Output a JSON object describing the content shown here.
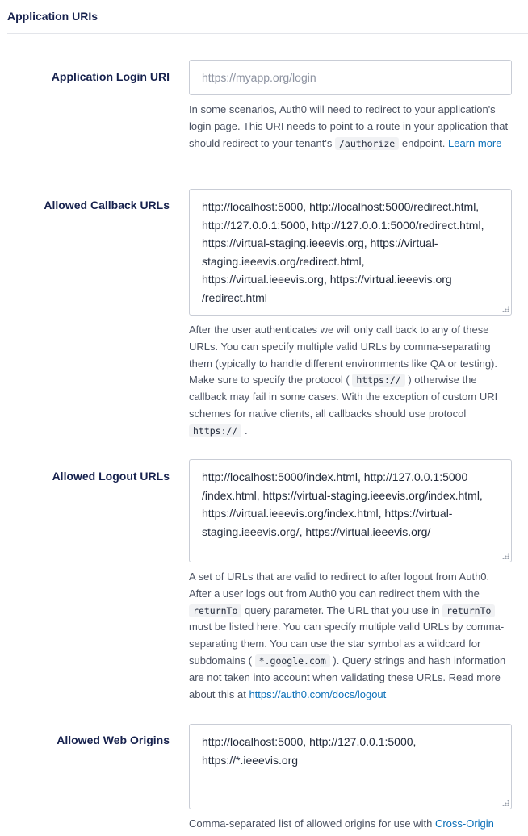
{
  "section": {
    "title": "Application URIs"
  },
  "login_uri": {
    "label": "Application Login URI",
    "placeholder": "https://myapp.org/login",
    "help_1": "In some scenarios, Auth0 will need to redirect to your application's login page. This URI needs to point to a route in your application that should redirect to your tenant's",
    "help_code": "/authorize",
    "help_2": "endpoint.",
    "help_link": "Learn more"
  },
  "callback_urls": {
    "label": "Allowed Callback URLs",
    "lines": [
      "http://localhost:5000, http://localhost:5000/redirect.html,",
      "http://127.0.0.1:5000, http://127.0.0.1:5000/redirect.html,",
      "https://virtual-staging.ieeevis.org, https://virtual-",
      "staging.ieeevis.org/redirect.html,",
      "https://virtual.ieeevis.org, https://virtual.ieeevis.org",
      "/redirect.html"
    ],
    "help_1": "After the user authenticates we will only call back to any of these URLs. You can specify multiple valid URLs by comma-separating them (typically to handle different environments like QA or testing). Make sure to specify the protocol (",
    "help_code_1": "https://",
    "help_2": ") otherwise the callback may fail in some cases. With the exception of custom URI schemes for native clients, all callbacks should use protocol",
    "help_code_2": "https://",
    "help_3": "."
  },
  "logout_urls": {
    "label": "Allowed Logout URLs",
    "lines": [
      "http://localhost:5000/index.html, http://127.0.0.1:5000",
      "/index.html, https://virtual-staging.ieeevis.org/index.html,",
      "https://virtual.ieeevis.org/index.html, https://virtual-",
      "staging.ieeevis.org/, https://virtual.ieeevis.org/"
    ],
    "help_1": "A set of URLs that are valid to redirect to after logout from Auth0. After a user logs out from Auth0 you can redirect them with the",
    "help_code_1": "returnTo",
    "help_2": "query parameter. The URL that you use in",
    "help_code_2": "returnTo",
    "help_3": "must be listed here. You can specify multiple valid URLs by comma-separating them. You can use the star symbol as a wildcard for subdomains (",
    "help_code_3": "*.google.com",
    "help_4": "). Query strings and hash information are not taken into account when validating these URLs. Read more about this at",
    "help_link": "https://auth0.com/docs/logout"
  },
  "web_origins": {
    "label": "Allowed Web Origins",
    "lines": [
      "http://localhost:5000, http://127.0.0.1:5000,",
      "https://*.ieeevis.org"
    ],
    "help_1": "Comma-separated list of allowed origins for use with",
    "help_link": "Cross-Origin"
  }
}
